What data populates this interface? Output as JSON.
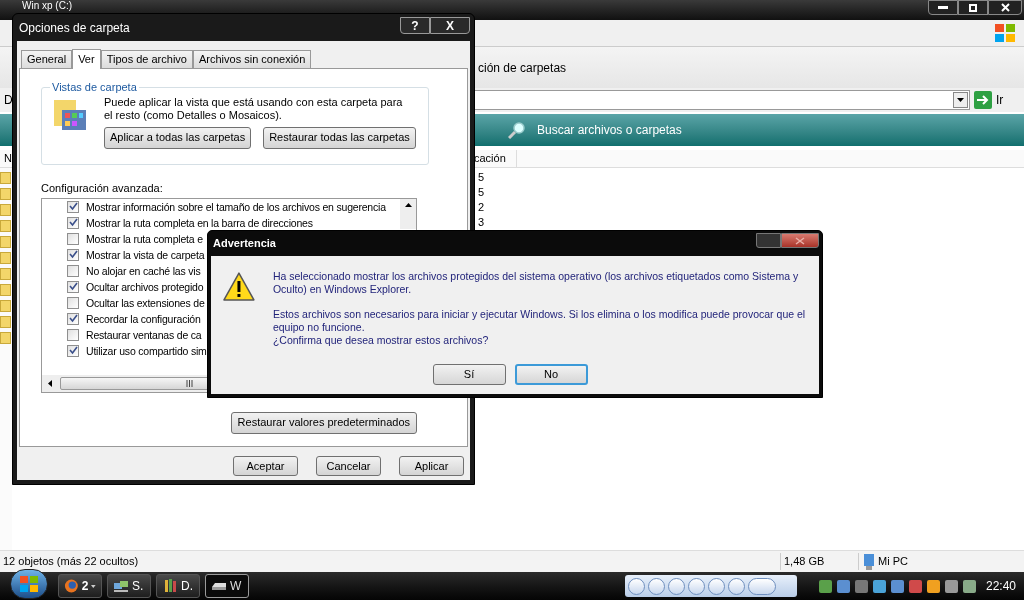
{
  "explorer": {
    "title": "Win xp (C:)",
    "toolbar_text": "ción de carpetas",
    "address_label": "D",
    "go_button": "Ir",
    "search_bar": "Buscar archivos o carpetas",
    "columns": [
      "N",
      "cación"
    ],
    "rows": [
      "5",
      "5",
      "2",
      "3"
    ],
    "status_bar": [
      "12 objetos (más 22 ocultos)",
      "1,48 GB",
      "Mi PC"
    ]
  },
  "folder_options": {
    "title": "Opciones de carpeta",
    "help_button": "?",
    "close_button": "X",
    "tabs": [
      {
        "label": "General",
        "selected": false
      },
      {
        "label": "Ver",
        "selected": true
      },
      {
        "label": "Tipos de archivo",
        "selected": false
      },
      {
        "label": "Archivos sin conexión",
        "selected": false
      }
    ],
    "folder_views": {
      "legend": "Vistas de carpeta",
      "text": "Puede aplicar la vista que está usando con esta carpeta para el resto (como Detalles o Mosaicos).",
      "buttons": [
        "Aplicar a todas las carpetas",
        "Restaurar todas las carpetas"
      ]
    },
    "advanced_label": "Configuración avanzada:",
    "settings": [
      {
        "label": "Mostrar información sobre el tamaño de los archivos en sugerencia",
        "checked": true
      },
      {
        "label": "Mostrar la ruta completa en la barra de direcciones",
        "checked": true
      },
      {
        "label": "Mostrar la ruta completa e",
        "checked": false
      },
      {
        "label": "Mostrar la vista de carpeta",
        "checked": true
      },
      {
        "label": "No alojar en caché las vis",
        "checked": false
      },
      {
        "label": "Ocultar archivos protegido",
        "checked": true
      },
      {
        "label": "Ocultar las extensiones de",
        "checked": false
      },
      {
        "label": "Recordar la configuración",
        "checked": true
      },
      {
        "label": "Restaurar ventanas de ca",
        "checked": false
      },
      {
        "label": "Utilizar uso compartido sim",
        "checked": true
      }
    ],
    "restore_defaults": "Restaurar valores predeterminados",
    "buttons": [
      "Aceptar",
      "Cancelar",
      "Aplicar"
    ]
  },
  "warning": {
    "title": "Advertencia",
    "paragraphs": [
      "Ha seleccionado mostrar los archivos protegidos del sistema operativo (los archivos etiquetados como Sistema y Oculto) en Windows Explorer.",
      "Estos archivos son necesarios para iniciar y ejecutar Windows. Si los elimina o los modifica puede provocar que el equipo no funcione.\n¿Confirma que desea mostrar estos archivos?"
    ],
    "buttons": [
      {
        "label": "Sí",
        "focused": false
      },
      {
        "label": "No",
        "focused": true
      }
    ]
  },
  "taskbar": {
    "buttons": [
      {
        "kind": "browser",
        "label": "2",
        "selected": false
      },
      {
        "kind": "network",
        "label": "S.",
        "selected": false
      },
      {
        "kind": "paint",
        "label": "D.",
        "selected": false
      },
      {
        "kind": "drive",
        "label": "W",
        "selected": true
      }
    ],
    "clock": "22:40"
  }
}
